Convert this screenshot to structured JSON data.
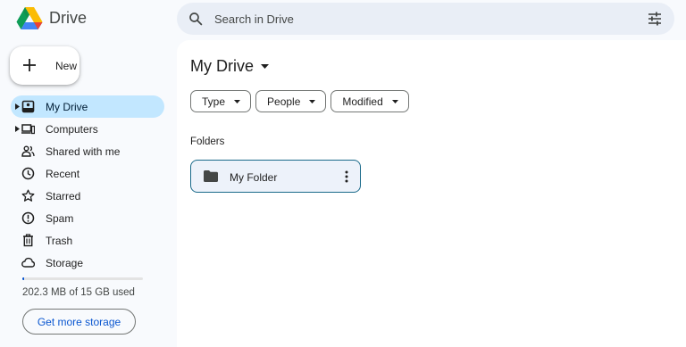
{
  "app": {
    "name": "Drive"
  },
  "search": {
    "placeholder": "Search in Drive"
  },
  "new_button": {
    "label": "New"
  },
  "sidebar": {
    "items": [
      {
        "label": "My Drive",
        "icon": "my-drive-icon",
        "active": true,
        "expandable": true
      },
      {
        "label": "Computers",
        "icon": "computers-icon",
        "active": false,
        "expandable": true
      },
      {
        "label": "Shared with me",
        "icon": "shared-icon",
        "active": false,
        "expandable": false
      },
      {
        "label": "Recent",
        "icon": "clock-icon",
        "active": false,
        "expandable": false
      },
      {
        "label": "Starred",
        "icon": "star-icon",
        "active": false,
        "expandable": false
      },
      {
        "label": "Spam",
        "icon": "spam-icon",
        "active": false,
        "expandable": false
      },
      {
        "label": "Trash",
        "icon": "trash-icon",
        "active": false,
        "expandable": false
      },
      {
        "label": "Storage",
        "icon": "cloud-icon",
        "active": false,
        "expandable": false
      }
    ],
    "storage": {
      "used_text": "202.3 MB of 15 GB used",
      "used_fraction": 0.013,
      "button_label": "Get more storage"
    }
  },
  "main": {
    "title": "My Drive",
    "filters": [
      {
        "label": "Type"
      },
      {
        "label": "People"
      },
      {
        "label": "Modified"
      }
    ],
    "folders_heading": "Folders",
    "folders": [
      {
        "name": "My Folder"
      }
    ]
  },
  "colors": {
    "page_bg": "#f8fafd",
    "search_bg": "#e9eef6",
    "active_nav_bg": "#c2e7ff",
    "accent_blue": "#0b57d0",
    "folder_card_bg": "#edf2fa",
    "folder_card_border": "#1a6a8a"
  }
}
